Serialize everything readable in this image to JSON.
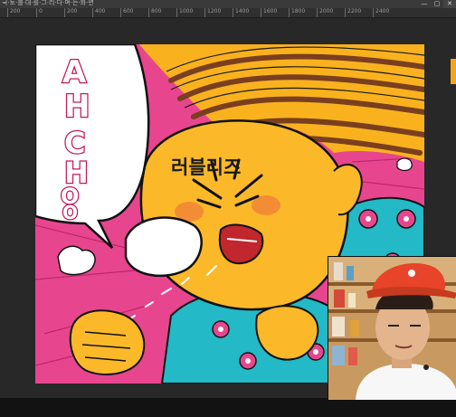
{
  "app": {
    "title": "국·토·블·대·를·그·리·다·며·는·화·면",
    "window_controls": [
      "—",
      "▢",
      "✕"
    ]
  },
  "ruler": {
    "ticks": [
      "200",
      "0",
      "200",
      "400",
      "600",
      "800",
      "1000",
      "1200",
      "1400",
      "1600",
      "1800",
      "2000",
      "2200",
      "2400"
    ]
  },
  "artwork": {
    "speech_bubble_text": "AH CHOO",
    "speech_letters": [
      "A",
      "H",
      "C",
      "H",
      "O",
      "O"
    ],
    "korean_label": "러블리즈"
  },
  "colors": {
    "pink": "#e7468f",
    "yellow": "#f9b21e",
    "face": "#fbb92a",
    "cyan": "#23b9c6",
    "brown": "#8a4e27",
    "bg": "#282828"
  },
  "icons": [
    "window-minimize-icon",
    "window-maximize-icon",
    "window-close-icon"
  ]
}
